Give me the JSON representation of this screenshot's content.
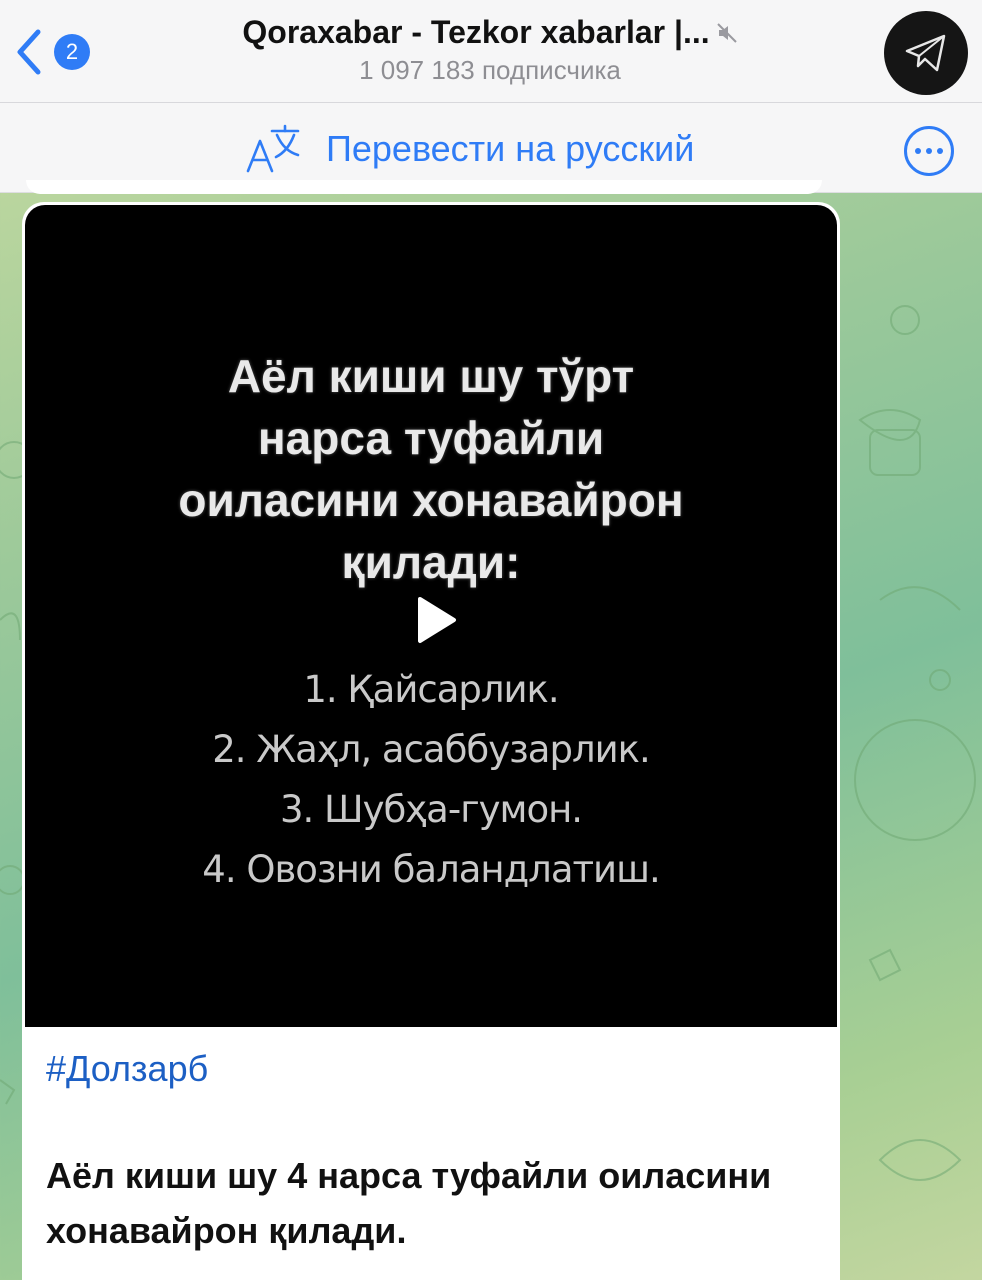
{
  "header": {
    "back_count": "2",
    "channel_title": "Qoraxabar - Tezkor xabarlar |...",
    "subscribers": "1 097 183 подписчика"
  },
  "translate_bar": {
    "label": "Перевести на русский"
  },
  "message": {
    "video_title_lines": [
      "Аёл киши шу тўрт",
      "нарса туфайли",
      "оиласини хонавайрон",
      "қилади:"
    ],
    "video_list": [
      "1. Қайсарлик.",
      "2. Жаҳл, асаббузарлик.",
      "3. Шубҳа-гумон.",
      "4. Овозни баландлатиш."
    ],
    "hashtag": "#Долзарб",
    "caption": "Аёл киши шу 4 нарса туфайли оиласини хонавайрон қилади."
  },
  "colors": {
    "accent": "#2f7cf6",
    "hashtag": "#1c5fc4",
    "header_bg": "#f6f6f7"
  },
  "icons": {
    "back": "chevron-left-icon",
    "mute": "muted-speaker-icon",
    "avatar": "paper-plane-icon",
    "translate": "translate-icon",
    "more": "ellipsis-circle-icon",
    "play": "play-icon"
  }
}
